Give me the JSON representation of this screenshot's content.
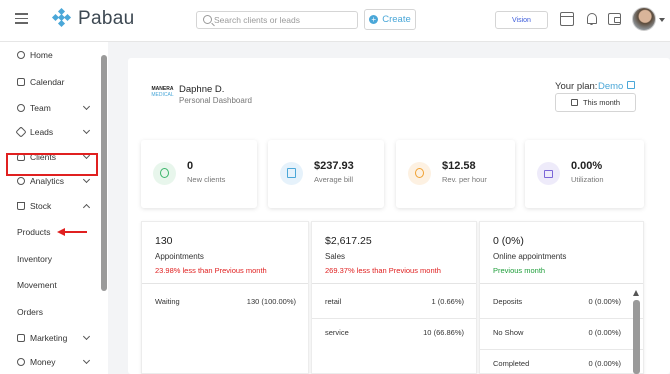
{
  "topbar": {
    "brand": "Pabau",
    "search_placeholder": "Search clients or leads",
    "create_label": "Create",
    "vision_label": "Vision",
    "icons": [
      "menu-icon",
      "calendar-icon",
      "bell-icon",
      "wallet-icon",
      "avatar"
    ]
  },
  "sidebar": {
    "items": [
      {
        "label": "Home",
        "icon": "home-icon"
      },
      {
        "label": "Calendar",
        "icon": "calendar-icon"
      },
      {
        "label": "Team",
        "icon": "team-icon"
      },
      {
        "label": "Leads",
        "icon": "leads-icon"
      },
      {
        "label": "Clients",
        "icon": "clients-icon"
      },
      {
        "label": "Analytics",
        "icon": "analytics-icon"
      },
      {
        "label": "Stock",
        "icon": "cart-icon"
      },
      {
        "label": "Marketing",
        "icon": "marketing-icon"
      },
      {
        "label": "Money",
        "icon": "money-icon"
      }
    ],
    "stock_sub": [
      "Products",
      "Inventory",
      "Movement",
      "Orders"
    ]
  },
  "dashboard": {
    "logo_line1": "MANERA",
    "logo_line2": "MEDICAL",
    "user_name": "Daphne D.",
    "user_sub": "Personal Dashboard",
    "plan_label": "Your plan:",
    "plan_value": "Demo",
    "period_label": "This month"
  },
  "stats": [
    {
      "value": "0",
      "label": "New clients",
      "color": "#e8f6ec"
    },
    {
      "value": "$237.93",
      "label": "Average bill",
      "color": "#e6f2fb"
    },
    {
      "value": "$12.58",
      "label": "Rev. per hour",
      "color": "#fdf1e2"
    },
    {
      "value": "0.00%",
      "label": "Utilization",
      "color": "#eeebfa"
    }
  ],
  "cards": [
    {
      "value": "130",
      "label": "Appointments",
      "compare": "23.98% less than Previous month",
      "compare_tone": "red",
      "rows": [
        {
          "name": "Waiting",
          "value": "130 (100.00%)"
        }
      ]
    },
    {
      "value": "$2,617.25",
      "label": "Sales",
      "compare": "269.37% less than Previous month",
      "compare_tone": "red",
      "rows": [
        {
          "name": "retail",
          "value": "1 (0.66%)"
        },
        {
          "name": "service",
          "value": "10 (66.86%)"
        }
      ]
    },
    {
      "value": "0 (0%)",
      "label": "Online appointments",
      "compare": "Previous month",
      "compare_tone": "green",
      "rows": [
        {
          "name": "Deposits",
          "value": "0 (0.00%)"
        },
        {
          "name": "No Show",
          "value": "0 (0.00%)"
        },
        {
          "name": "Completed",
          "value": "0 (0.00%)"
        }
      ]
    }
  ],
  "colors": {
    "accent": "#4aa7d8",
    "annotation": "#e02020"
  }
}
